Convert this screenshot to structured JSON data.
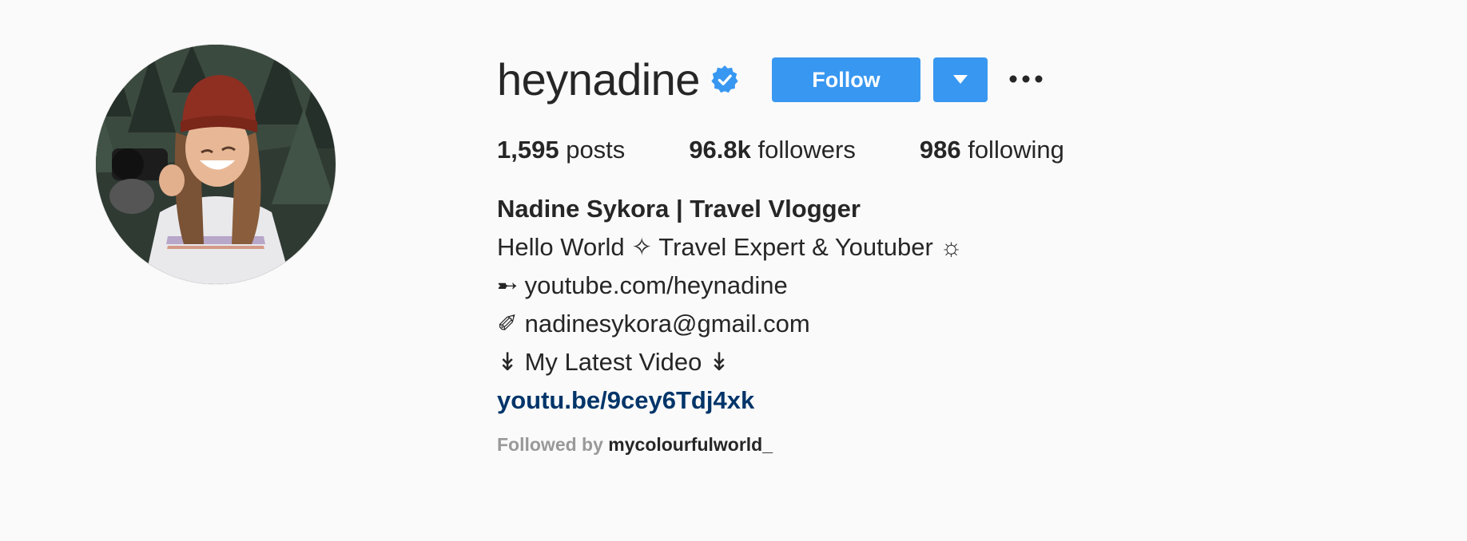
{
  "profile": {
    "username": "heynadine",
    "verified": true,
    "follow_label": "Follow",
    "stats": {
      "posts_count": "1,595",
      "posts_label": "posts",
      "followers_count": "96.8k",
      "followers_label": "followers",
      "following_count": "986",
      "following_label": "following"
    },
    "bio": {
      "full_name": "Nadine Sykora | Travel Vlogger",
      "line1": "Hello World ✧ Travel Expert & Youtuber ☼",
      "line2": "➸ youtube.com/heynadine",
      "line3": "✐ nadinesykora@gmail.com",
      "line4": "↡ My Latest Video ↡",
      "link": "youtu.be/9cey6Tdj4xk"
    },
    "followed_by": {
      "prefix": "Followed by",
      "name": "mycolourfulworld_"
    }
  },
  "colors": {
    "accent": "#3897f0",
    "link": "#003569",
    "background": "#fafafa",
    "text": "#262626",
    "muted": "#999999"
  },
  "icons": {
    "verified": "verified-badge-icon",
    "dropdown": "caret-down-icon",
    "more": "more-options-icon"
  }
}
